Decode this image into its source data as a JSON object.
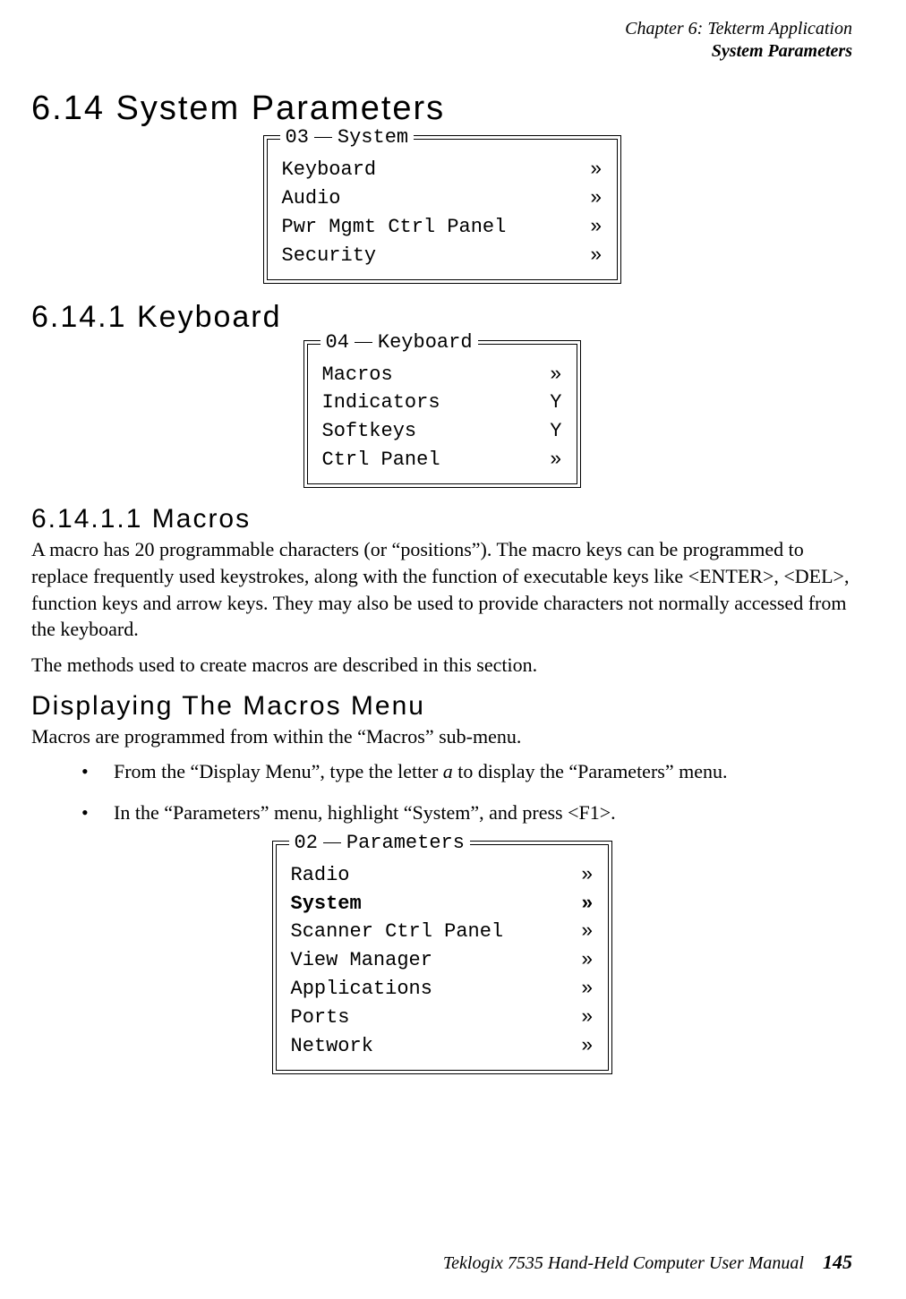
{
  "header": {
    "line1": "Chapter 6: Tekterm Application",
    "line2": "System Parameters"
  },
  "h1": "6.14  System Parameters",
  "menu_system": {
    "legend_num": "03",
    "legend_title": "System",
    "rows": [
      {
        "label": "Keyboard",
        "value": "»"
      },
      {
        "label": "Audio",
        "value": "»"
      },
      {
        "label": "Pwr Mgmt Ctrl Panel",
        "value": "»"
      },
      {
        "label": "Security",
        "value": "»"
      }
    ]
  },
  "h2": "6.14.1  Keyboard",
  "menu_keyboard": {
    "legend_num": "04",
    "legend_title": "Keyboard",
    "rows": [
      {
        "label": "Macros",
        "value": "»"
      },
      {
        "label": "Indicators",
        "value": "Y"
      },
      {
        "label": "Softkeys",
        "value": "Y"
      },
      {
        "label": "Ctrl Panel",
        "value": "»"
      }
    ]
  },
  "h3": "6.14.1.1  Macros",
  "para1": "A macro has 20 programmable characters (or “positions”). The macro keys can be programmed to replace frequently used keystrokes, along with the function of executable keys like <ENTER>, <DEL>, function keys and arrow keys. They may also be used to provide characters not normally accessed from the keyboard.",
  "para2": "The methods used to create macros are described in this section.",
  "h3b": "Displaying The Macros Menu",
  "para3": "Macros are programmed from within the “Macros” sub-menu.",
  "bullet1_a": "From the “Display Menu”, type the letter ",
  "bullet1_em": "a",
  "bullet1_b": " to display the “Parameters” menu.",
  "bullet2": "In the “Parameters” menu, highlight “System”, and press <F1>.",
  "menu_parameters": {
    "legend_num": "02",
    "legend_title": "Parameters",
    "rows": [
      {
        "label": "Radio",
        "value": "»",
        "bold": false
      },
      {
        "label": "System",
        "value": "»",
        "bold": true
      },
      {
        "label": "Scanner Ctrl Panel",
        "value": "»",
        "bold": false
      },
      {
        "label": "View Manager",
        "value": "»",
        "bold": false
      },
      {
        "label": "Applications",
        "value": "»",
        "bold": false
      },
      {
        "label": "Ports",
        "value": "»",
        "bold": false
      },
      {
        "label": "Network",
        "value": "»",
        "bold": false
      }
    ]
  },
  "footer": {
    "book": "Teklogix 7535 Hand-Held Computer User Manual",
    "page": "145"
  }
}
